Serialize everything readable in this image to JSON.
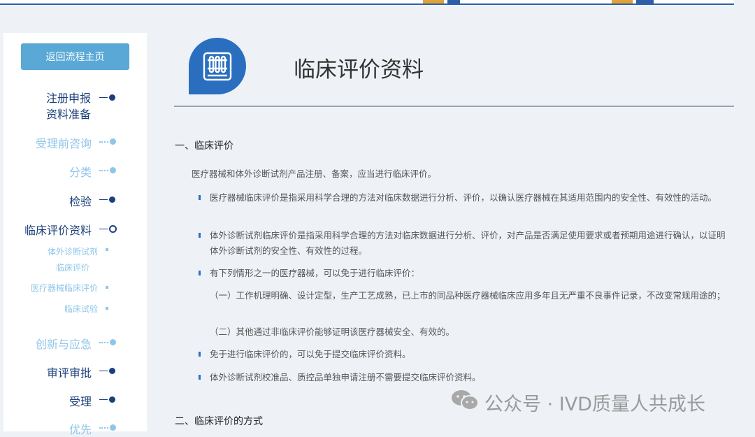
{
  "sidebar": {
    "back_label": "返回流程主页",
    "items": [
      {
        "label_line1": "注册申报",
        "label_line2": "资料准备"
      },
      {
        "label": "受理前咨询"
      },
      {
        "label": "分类"
      },
      {
        "label": "检验"
      },
      {
        "label": "临床评价资料"
      },
      {
        "label": "创新与应急"
      },
      {
        "label": "审评审批"
      },
      {
        "label": "受理"
      },
      {
        "label": "优先"
      }
    ],
    "subitems": [
      {
        "line1": "体外诊断试剂",
        "line2": "临床评价"
      },
      {
        "line1": "医疗器械临床评价",
        "line2": "临床试验"
      }
    ]
  },
  "header": {
    "title": "临床评价资料",
    "icon": "test-tubes-icon"
  },
  "content": {
    "section1_title": "一、临床评价",
    "intro": "医疗器械和体外诊断试剂产品注册、备案，应当进行临床评价。",
    "bullets": [
      "医疗器械临床评价是指采用科学合理的方法对临床数据进行分析、评价，以确认医疗器械在其适用范围内的安全性、有效性的活动。",
      "体外诊断试剂临床评价是指采用科学合理的方法对临床数据进行分析、评价，对产品是否满足使用要求或者预期用途进行确认，以证明体外诊断试剂的安全性、有效性的过程。",
      "有下列情形之一的医疗器械，可以免于进行临床评价："
    ],
    "subpoints": [
      "（一）工作机理明确、设计定型，生产工艺成熟，已上市的同品种医疗器械临床应用多年且无严重不良事件记录，不改变常规用途的；",
      "（二）其他通过非临床评价能够证明该医疗器械安全、有效的。"
    ],
    "bullets2": [
      "免于进行临床评价的，可以免于提交临床评价资料。",
      "体外诊断试剂校准品、质控品单独申请注册不需要提交临床评价资料。"
    ],
    "section2_title": "二、临床评价的方式"
  },
  "watermark": {
    "text": "公众号 · IVD质量人共成长",
    "icon": "wechat-icon"
  },
  "colors": {
    "accent": "#2a6fbf",
    "nav_dark": "#1b3f7a",
    "nav_light": "#8fc6e8",
    "button": "#5aa8d6"
  }
}
